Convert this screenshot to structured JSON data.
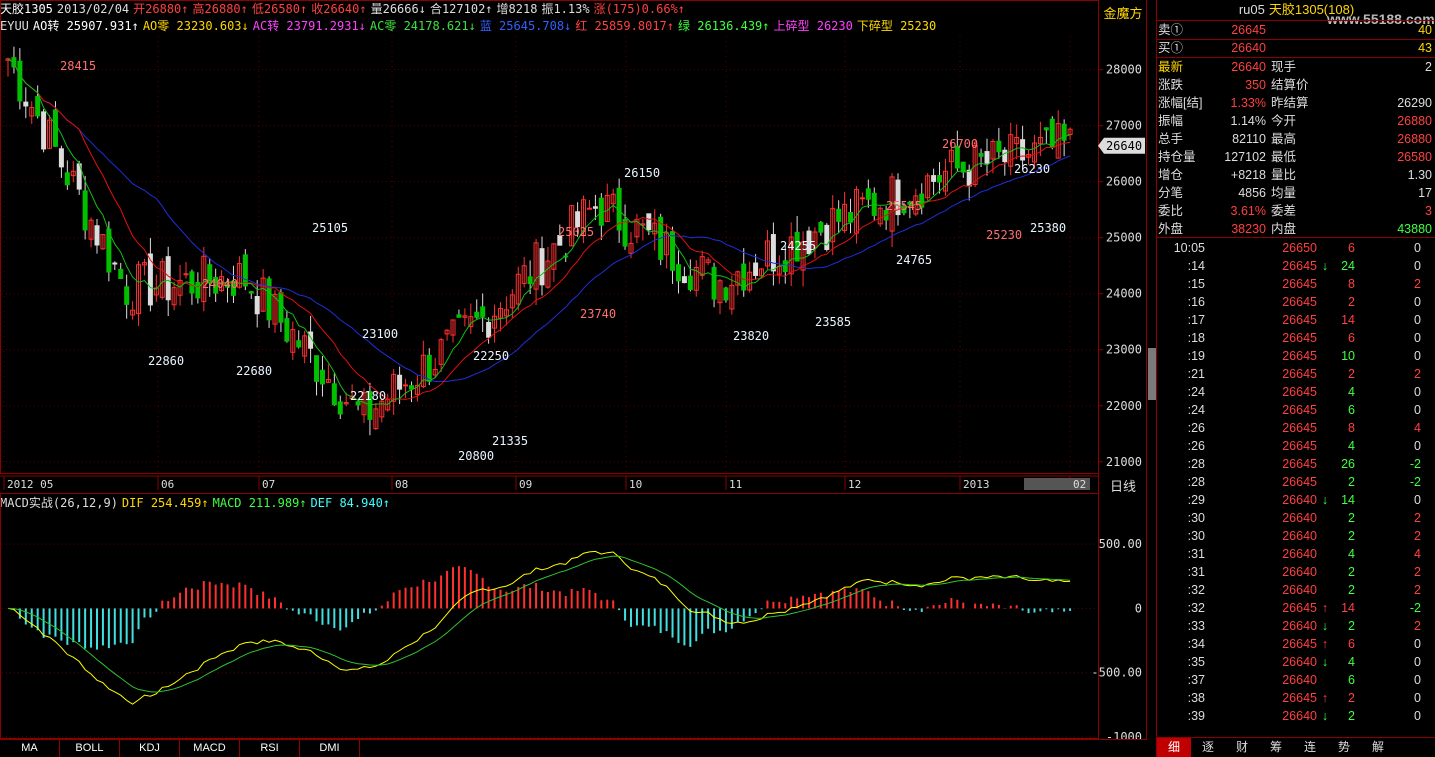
{
  "header": {
    "segments": [
      {
        "text": "天胶1305",
        "color": "#ffffff"
      },
      {
        "text": "2013/02/04",
        "color": "#dddddd"
      },
      {
        "text": "开26880↑",
        "color": "#ff4040"
      },
      {
        "text": "高26880↑",
        "color": "#ff4040"
      },
      {
        "text": "低26580↑",
        "color": "#ff4040"
      },
      {
        "text": "收26640↑",
        "color": "#ff4040"
      },
      {
        "text": "量26666↓",
        "color": "#dddddd"
      },
      {
        "text": "合127102↑",
        "color": "#dddddd"
      },
      {
        "text": "增8218",
        "color": "#dddddd"
      },
      {
        "text": "振1.13%",
        "color": "#dddddd"
      },
      {
        "text": "涨(175)0.66%↑",
        "color": "#ff4040"
      }
    ]
  },
  "indicators": {
    "segments": [
      {
        "text": "EYUU",
        "color": "#dddddd"
      },
      {
        "text": "AO转 25907.931↑",
        "color": "#ffffff"
      },
      {
        "text": "AO零 23230.603↓",
        "color": "#ffd700"
      },
      {
        "text": "AC转 23791.2931↓",
        "color": "#ff40ff"
      },
      {
        "text": "AC零 24178.621↓",
        "color": "#40e040"
      },
      {
        "text": "蓝 25645.708↓",
        "color": "#3060ff"
      },
      {
        "text": "红 25859.8017↑",
        "color": "#ff4040"
      },
      {
        "text": "绿 26136.439↑",
        "color": "#40ff40"
      },
      {
        "text": "上碎型 26230",
        "color": "#ff40ff"
      },
      {
        "text": "下碎型 25230",
        "color": "#ffd700"
      }
    ]
  },
  "axis_unit": "金魔方",
  "period": "日线",
  "macd_header": {
    "segments": [
      {
        "text": "MACD实战(26,12,9)",
        "color": "#dddddd"
      },
      {
        "text": "DIF 254.459↑",
        "color": "#ffd700"
      },
      {
        "text": "MACD 211.989↑",
        "color": "#40ff40"
      },
      {
        "text": "DEF 84.940↑",
        "color": "#40ffff"
      }
    ]
  },
  "current_price_label": "26640",
  "price_axis_ticks": [
    "28000",
    "27000",
    "26000",
    "25000",
    "24000",
    "23000",
    "22000",
    "21000"
  ],
  "macd_axis_ticks": [
    "500.00",
    "0",
    "-500.00",
    "-1000"
  ],
  "time_axis": [
    "2012 05",
    "06",
    "07",
    "08",
    "09",
    "10",
    "11",
    "12",
    "2013",
    "02"
  ],
  "annotations": [
    "28415",
    "25105",
    "24040",
    "22860",
    "22680",
    "23100",
    "22180",
    "22250",
    "21335",
    "20800",
    "25025",
    "26150",
    "23740",
    "24255",
    "23820",
    "23585",
    "25545",
    "24765",
    "26700",
    "26230",
    "25230",
    "25380"
  ],
  "tabs": [
    "MA",
    "BOLL",
    "KDJ",
    "MACD",
    "RSI",
    "DMI"
  ],
  "quote": {
    "title_code": "ru05",
    "title_name": "天胶1305(108)",
    "watermark": "www.55188.com",
    "sell_label": "卖①",
    "sell_price": "26645",
    "sell_vol": "40",
    "buy_label": "买①",
    "buy_price": "26640",
    "buy_vol": "43",
    "rows": [
      {
        "l1": "最新",
        "v1": "26640",
        "c1": "#ff4040",
        "l2": "现手",
        "v2": "2",
        "c2": "#dddddd",
        "gold": true
      },
      {
        "l1": "涨跌",
        "v1": "350",
        "c1": "#ff4040",
        "l2": "结算价",
        "v2": "",
        "c2": "#dddddd"
      },
      {
        "l1": "涨幅[结]",
        "v1": "1.33%",
        "c1": "#ff4040",
        "l2": "昨结算",
        "v2": "26290",
        "c2": "#dddddd"
      },
      {
        "l1": "振幅",
        "v1": "1.14%",
        "c1": "#dddddd",
        "l2": "今开",
        "v2": "26880",
        "c2": "#ff4040"
      },
      {
        "l1": "总手",
        "v1": "82110",
        "c1": "#dddddd",
        "l2": "最高",
        "v2": "26880",
        "c2": "#ff4040"
      },
      {
        "l1": "持仓量",
        "v1": "127102",
        "c1": "#dddddd",
        "l2": "最低",
        "v2": "26580",
        "c2": "#ff4040"
      },
      {
        "l1": "增仓",
        "v1": "+8218",
        "c1": "#dddddd",
        "l2": "量比",
        "v2": "1.30",
        "c2": "#dddddd"
      },
      {
        "l1": "分笔",
        "v1": "4856",
        "c1": "#dddddd",
        "l2": "均量",
        "v2": "17",
        "c2": "#dddddd"
      },
      {
        "l1": "委比",
        "v1": "3.61%",
        "c1": "#ff4040",
        "l2": "委差",
        "v2": "3",
        "c2": "#ff4040"
      },
      {
        "l1": "外盘",
        "v1": "38230",
        "c1": "#ff4040",
        "l2": "内盘",
        "v2": "43880",
        "c2": "#40ff40"
      }
    ]
  },
  "trades": [
    {
      "time": "10:05",
      "price": "26650",
      "arrow": "",
      "vol": "6",
      "oi": "0",
      "pc": "#ff4040",
      "vc": "#ff4040",
      "oc": "#dddddd"
    },
    {
      "time": ":14",
      "price": "26645",
      "arrow": "↓",
      "vol": "24",
      "oi": "0",
      "pc": "#ff4040",
      "vc": "#40ff40",
      "oc": "#dddddd"
    },
    {
      "time": ":15",
      "price": "26645",
      "arrow": "",
      "vol": "8",
      "oi": "2",
      "pc": "#ff4040",
      "vc": "#ff4040",
      "oc": "#ff4040"
    },
    {
      "time": ":16",
      "price": "26645",
      "arrow": "",
      "vol": "2",
      "oi": "0",
      "pc": "#ff4040",
      "vc": "#ff4040",
      "oc": "#dddddd"
    },
    {
      "time": ":17",
      "price": "26645",
      "arrow": "",
      "vol": "14",
      "oi": "0",
      "pc": "#ff4040",
      "vc": "#ff4040",
      "oc": "#dddddd"
    },
    {
      "time": ":18",
      "price": "26645",
      "arrow": "",
      "vol": "6",
      "oi": "0",
      "pc": "#ff4040",
      "vc": "#ff4040",
      "oc": "#dddddd"
    },
    {
      "time": ":19",
      "price": "26645",
      "arrow": "",
      "vol": "10",
      "oi": "0",
      "pc": "#ff4040",
      "vc": "#40ff40",
      "oc": "#dddddd"
    },
    {
      "time": ":21",
      "price": "26645",
      "arrow": "",
      "vol": "2",
      "oi": "2",
      "pc": "#ff4040",
      "vc": "#ff4040",
      "oc": "#ff4040"
    },
    {
      "time": ":24",
      "price": "26645",
      "arrow": "",
      "vol": "4",
      "oi": "0",
      "pc": "#ff4040",
      "vc": "#40ff40",
      "oc": "#dddddd"
    },
    {
      "time": ":24",
      "price": "26645",
      "arrow": "",
      "vol": "6",
      "oi": "0",
      "pc": "#ff4040",
      "vc": "#40ff40",
      "oc": "#dddddd"
    },
    {
      "time": ":26",
      "price": "26645",
      "arrow": "",
      "vol": "8",
      "oi": "4",
      "pc": "#ff4040",
      "vc": "#ff4040",
      "oc": "#ff4040"
    },
    {
      "time": ":26",
      "price": "26645",
      "arrow": "",
      "vol": "4",
      "oi": "0",
      "pc": "#ff4040",
      "vc": "#40ff40",
      "oc": "#dddddd"
    },
    {
      "time": ":28",
      "price": "26645",
      "arrow": "",
      "vol": "26",
      "oi": "-2",
      "pc": "#ff4040",
      "vc": "#40ff40",
      "oc": "#40ff40"
    },
    {
      "time": ":28",
      "price": "26645",
      "arrow": "",
      "vol": "2",
      "oi": "-2",
      "pc": "#ff4040",
      "vc": "#40ff40",
      "oc": "#40ff40"
    },
    {
      "time": ":29",
      "price": "26640",
      "arrow": "↓",
      "vol": "14",
      "oi": "0",
      "pc": "#ff4040",
      "vc": "#40ff40",
      "oc": "#dddddd"
    },
    {
      "time": ":30",
      "price": "26640",
      "arrow": "",
      "vol": "2",
      "oi": "2",
      "pc": "#ff4040",
      "vc": "#40ff40",
      "oc": "#ff4040"
    },
    {
      "time": ":30",
      "price": "26640",
      "arrow": "",
      "vol": "2",
      "oi": "2",
      "pc": "#ff4040",
      "vc": "#40ff40",
      "oc": "#ff4040"
    },
    {
      "time": ":31",
      "price": "26640",
      "arrow": "",
      "vol": "4",
      "oi": "4",
      "pc": "#ff4040",
      "vc": "#40ff40",
      "oc": "#ff4040"
    },
    {
      "time": ":31",
      "price": "26640",
      "arrow": "",
      "vol": "2",
      "oi": "2",
      "pc": "#ff4040",
      "vc": "#40ff40",
      "oc": "#ff4040"
    },
    {
      "time": ":32",
      "price": "26640",
      "arrow": "",
      "vol": "2",
      "oi": "2",
      "pc": "#ff4040",
      "vc": "#40ff40",
      "oc": "#ff4040"
    },
    {
      "time": ":32",
      "price": "26645",
      "arrow": "↑",
      "vol": "14",
      "oi": "-2",
      "pc": "#ff4040",
      "vc": "#ff4040",
      "oc": "#40ff40"
    },
    {
      "time": ":33",
      "price": "26640",
      "arrow": "↓",
      "vol": "2",
      "oi": "2",
      "pc": "#ff4040",
      "vc": "#40ff40",
      "oc": "#ff4040"
    },
    {
      "time": ":34",
      "price": "26645",
      "arrow": "↑",
      "vol": "6",
      "oi": "0",
      "pc": "#ff4040",
      "vc": "#ff4040",
      "oc": "#dddddd"
    },
    {
      "time": ":35",
      "price": "26640",
      "arrow": "↓",
      "vol": "4",
      "oi": "0",
      "pc": "#ff4040",
      "vc": "#40ff40",
      "oc": "#dddddd"
    },
    {
      "time": ":37",
      "price": "26640",
      "arrow": "",
      "vol": "6",
      "oi": "0",
      "pc": "#ff4040",
      "vc": "#40ff40",
      "oc": "#dddddd"
    },
    {
      "time": ":38",
      "price": "26645",
      "arrow": "↑",
      "vol": "2",
      "oi": "0",
      "pc": "#ff4040",
      "vc": "#ff4040",
      "oc": "#dddddd"
    },
    {
      "time": ":39",
      "price": "26640",
      "arrow": "↓",
      "vol": "2",
      "oi": "0",
      "pc": "#ff4040",
      "vc": "#40ff40",
      "oc": "#dddddd"
    }
  ],
  "right_tabs": [
    "细",
    "逐",
    "财",
    "筹",
    "连",
    "势",
    "解"
  ],
  "chart_data": {
    "type": "candlestick",
    "price_range": [
      20800,
      28600
    ],
    "macd_range": [
      -1000,
      750
    ],
    "key_closes": [
      {
        "label": "2012-05",
        "close": 28200
      },
      {
        "label": "2012-06",
        "close": 24100
      },
      {
        "label": "2012-07",
        "close": 24300
      },
      {
        "label": "2012-08",
        "close": 21800
      },
      {
        "label": "2012-09",
        "close": 23500
      },
      {
        "label": "2012-10",
        "close": 25600
      },
      {
        "label": "2012-11",
        "close": 24200
      },
      {
        "label": "2012-12",
        "close": 25300
      },
      {
        "label": "2013-01",
        "close": 26200
      },
      {
        "label": "2013-02",
        "close": 26640
      }
    ]
  }
}
